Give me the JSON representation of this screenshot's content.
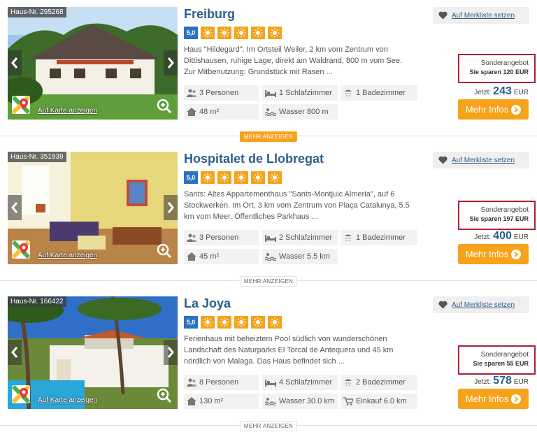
{
  "listings": [
    {
      "hausnr": "Haus-Nr. 295268",
      "title": "Freiburg",
      "score": "5,0",
      "suns": 5,
      "description": "Haus \"Hildegard\". Im Ortsteil Weiler, 2 km vom Zentrum von Dittishausen, ruhige Lage, direkt am Waldrand, 800 m vom See. Zur Mitbenutzung: Grundstück mit Rasen ...",
      "map_link": "Auf Karte anzeigen",
      "merkliste": "Auf Merkliste setzen",
      "offer_label": "Sonderangebot",
      "offer_savings": "Sie sparen 120 EUR",
      "price_prefix": "Jetzt:",
      "price": "243",
      "currency": "EUR",
      "cta": "Mehr Infos",
      "facts": [
        {
          "icon": "persons-icon",
          "text": "3 Personen"
        },
        {
          "icon": "bed-icon",
          "text": "1 Schlafzimmer"
        },
        {
          "icon": "shower-icon",
          "text": "1 Badezimmer"
        },
        {
          "icon": "house-icon",
          "text": "48 m²"
        },
        {
          "icon": "water-icon",
          "text": "Wasser 800 m"
        }
      ],
      "more": "MEHR ANZEIGEN"
    },
    {
      "hausnr": "Haus-Nr. 351939",
      "title": "Hospitalet de Llobregat",
      "score": "5,0",
      "suns": 5,
      "description": "Sants: Altes Appartementhaus \"Sants-Montjuic Almeria\", auf 6 Stockwerken. Im Ort, 3 km vom Zentrum von Plaça Catalunya, 5.5 km vom Meer. Öffentliches Parkhaus ...",
      "map_link": "Auf Karte anzeigen",
      "merkliste": "Auf Merkliste setzen",
      "offer_label": "Sonderangebot",
      "offer_savings": "Sie sparen 197 EUR",
      "price_prefix": "Jetzt:",
      "price": "400",
      "currency": "EUR",
      "cta": "Mehr Infos",
      "facts": [
        {
          "icon": "persons-icon",
          "text": "3 Personen"
        },
        {
          "icon": "bed-icon",
          "text": "2 Schlafzimmer"
        },
        {
          "icon": "shower-icon",
          "text": "1 Badezimmer"
        },
        {
          "icon": "house-icon",
          "text": "45 m²"
        },
        {
          "icon": "water-icon",
          "text": "Wasser 5.5 km"
        }
      ],
      "more": "MEHR ANZEIGEN"
    },
    {
      "hausnr": "Haus-Nr. 166422",
      "title": "La Joya",
      "score": "5,0",
      "suns": 5,
      "description": "Ferienhaus mit beheiztem Pool südlich von wunderschönen Landschaft des Naturparks El Torcal de Antequera und 45 km nördlich von Malaga. Das Haus befindet sich ...",
      "map_link": "Auf Karte anzeigen",
      "merkliste": "Auf Merkliste setzen",
      "offer_label": "Sonderangebot",
      "offer_savings": "Sie sparen 55 EUR",
      "price_prefix": "Jetzt:",
      "price": "578",
      "currency": "EUR",
      "cta": "Mehr Infos",
      "facts": [
        {
          "icon": "persons-icon",
          "text": "8 Personen"
        },
        {
          "icon": "bed-icon",
          "text": "4 Schlafzimmer"
        },
        {
          "icon": "shower-icon",
          "text": "2 Badezimmer"
        },
        {
          "icon": "house-icon",
          "text": "130 m²"
        },
        {
          "icon": "water-icon",
          "text": "Wasser 30.0 km"
        },
        {
          "icon": "cart-icon",
          "text": "Einkauf 6.0 km"
        }
      ],
      "more": "MEHR ANZEIGEN"
    }
  ],
  "colors": {
    "title": "#2c5f8a",
    "score_badge": "#2c72c0",
    "sun_badge": "#f5a31a",
    "cta": "#f7a21b",
    "offer_border": "#b02033"
  }
}
